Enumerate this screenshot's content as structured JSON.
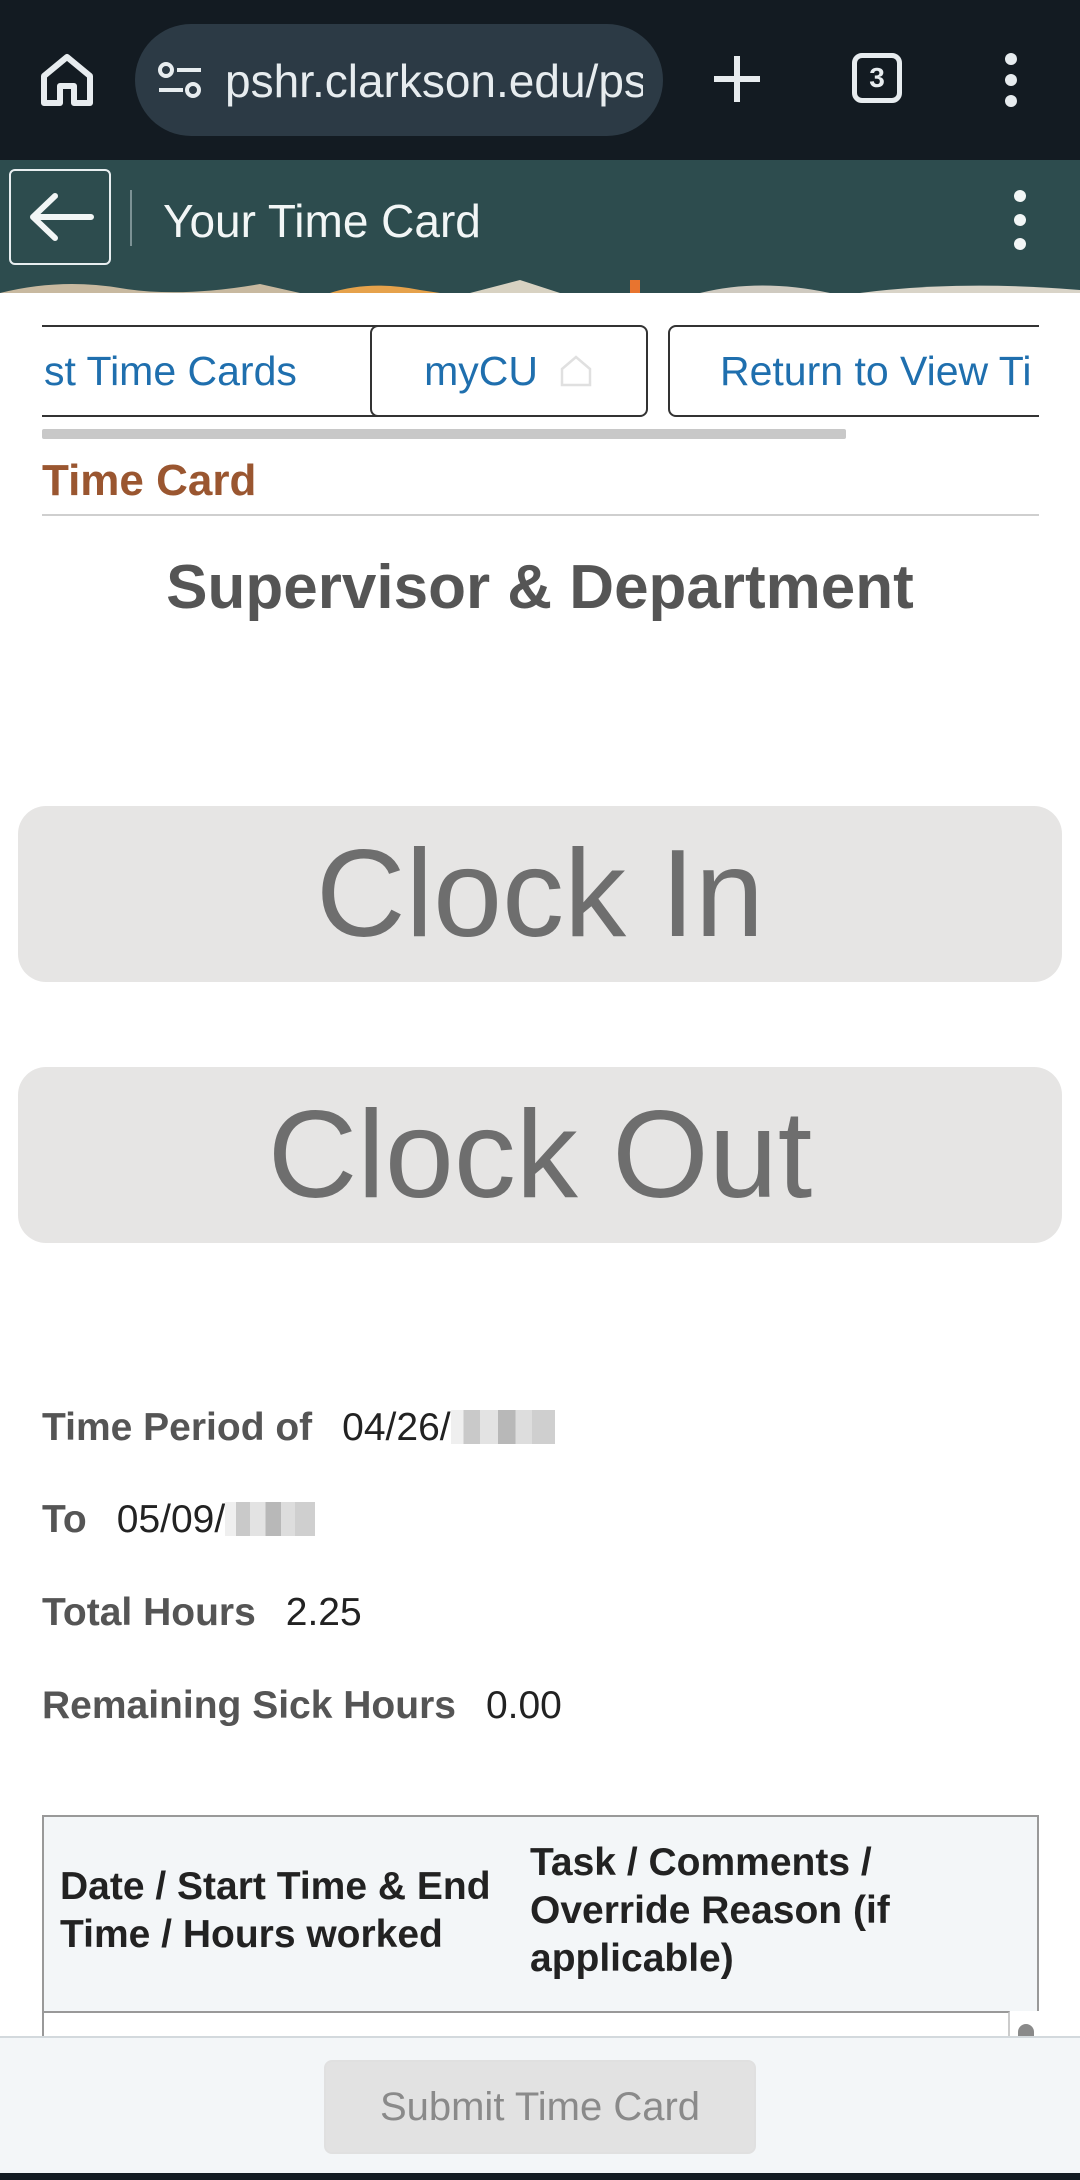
{
  "browser": {
    "url": "pshr.clarkson.edu/ps",
    "tab_count": "3"
  },
  "header": {
    "title": "Your Time Card"
  },
  "nav": {
    "items": [
      {
        "label": "st Time Cards"
      },
      {
        "label": "myCU"
      },
      {
        "label": "Return to View Ti"
      }
    ]
  },
  "section_label": "Time Card",
  "heading": "Supervisor & Department",
  "actions": {
    "clock_in": "Clock In",
    "clock_out": "Clock Out"
  },
  "info": {
    "time_period_label": "Time Period of",
    "time_period_value": "04/26/",
    "to_label": "To",
    "to_value": "05/09/",
    "total_hours_label": "Total Hours",
    "total_hours_value": "2.25",
    "sick_label": "Remaining Sick Hours",
    "sick_value": "0.00"
  },
  "table": {
    "headers": [
      "Date / Start Time & End Time / Hours worked",
      "Task / Comments / Override Reason (if applicable)"
    ]
  },
  "footer": {
    "submit_label": "Submit Time Card"
  },
  "colors": {
    "header_bg": "#2d4c4e",
    "link": "#1f6fae",
    "section_accent": "#9a5630"
  }
}
